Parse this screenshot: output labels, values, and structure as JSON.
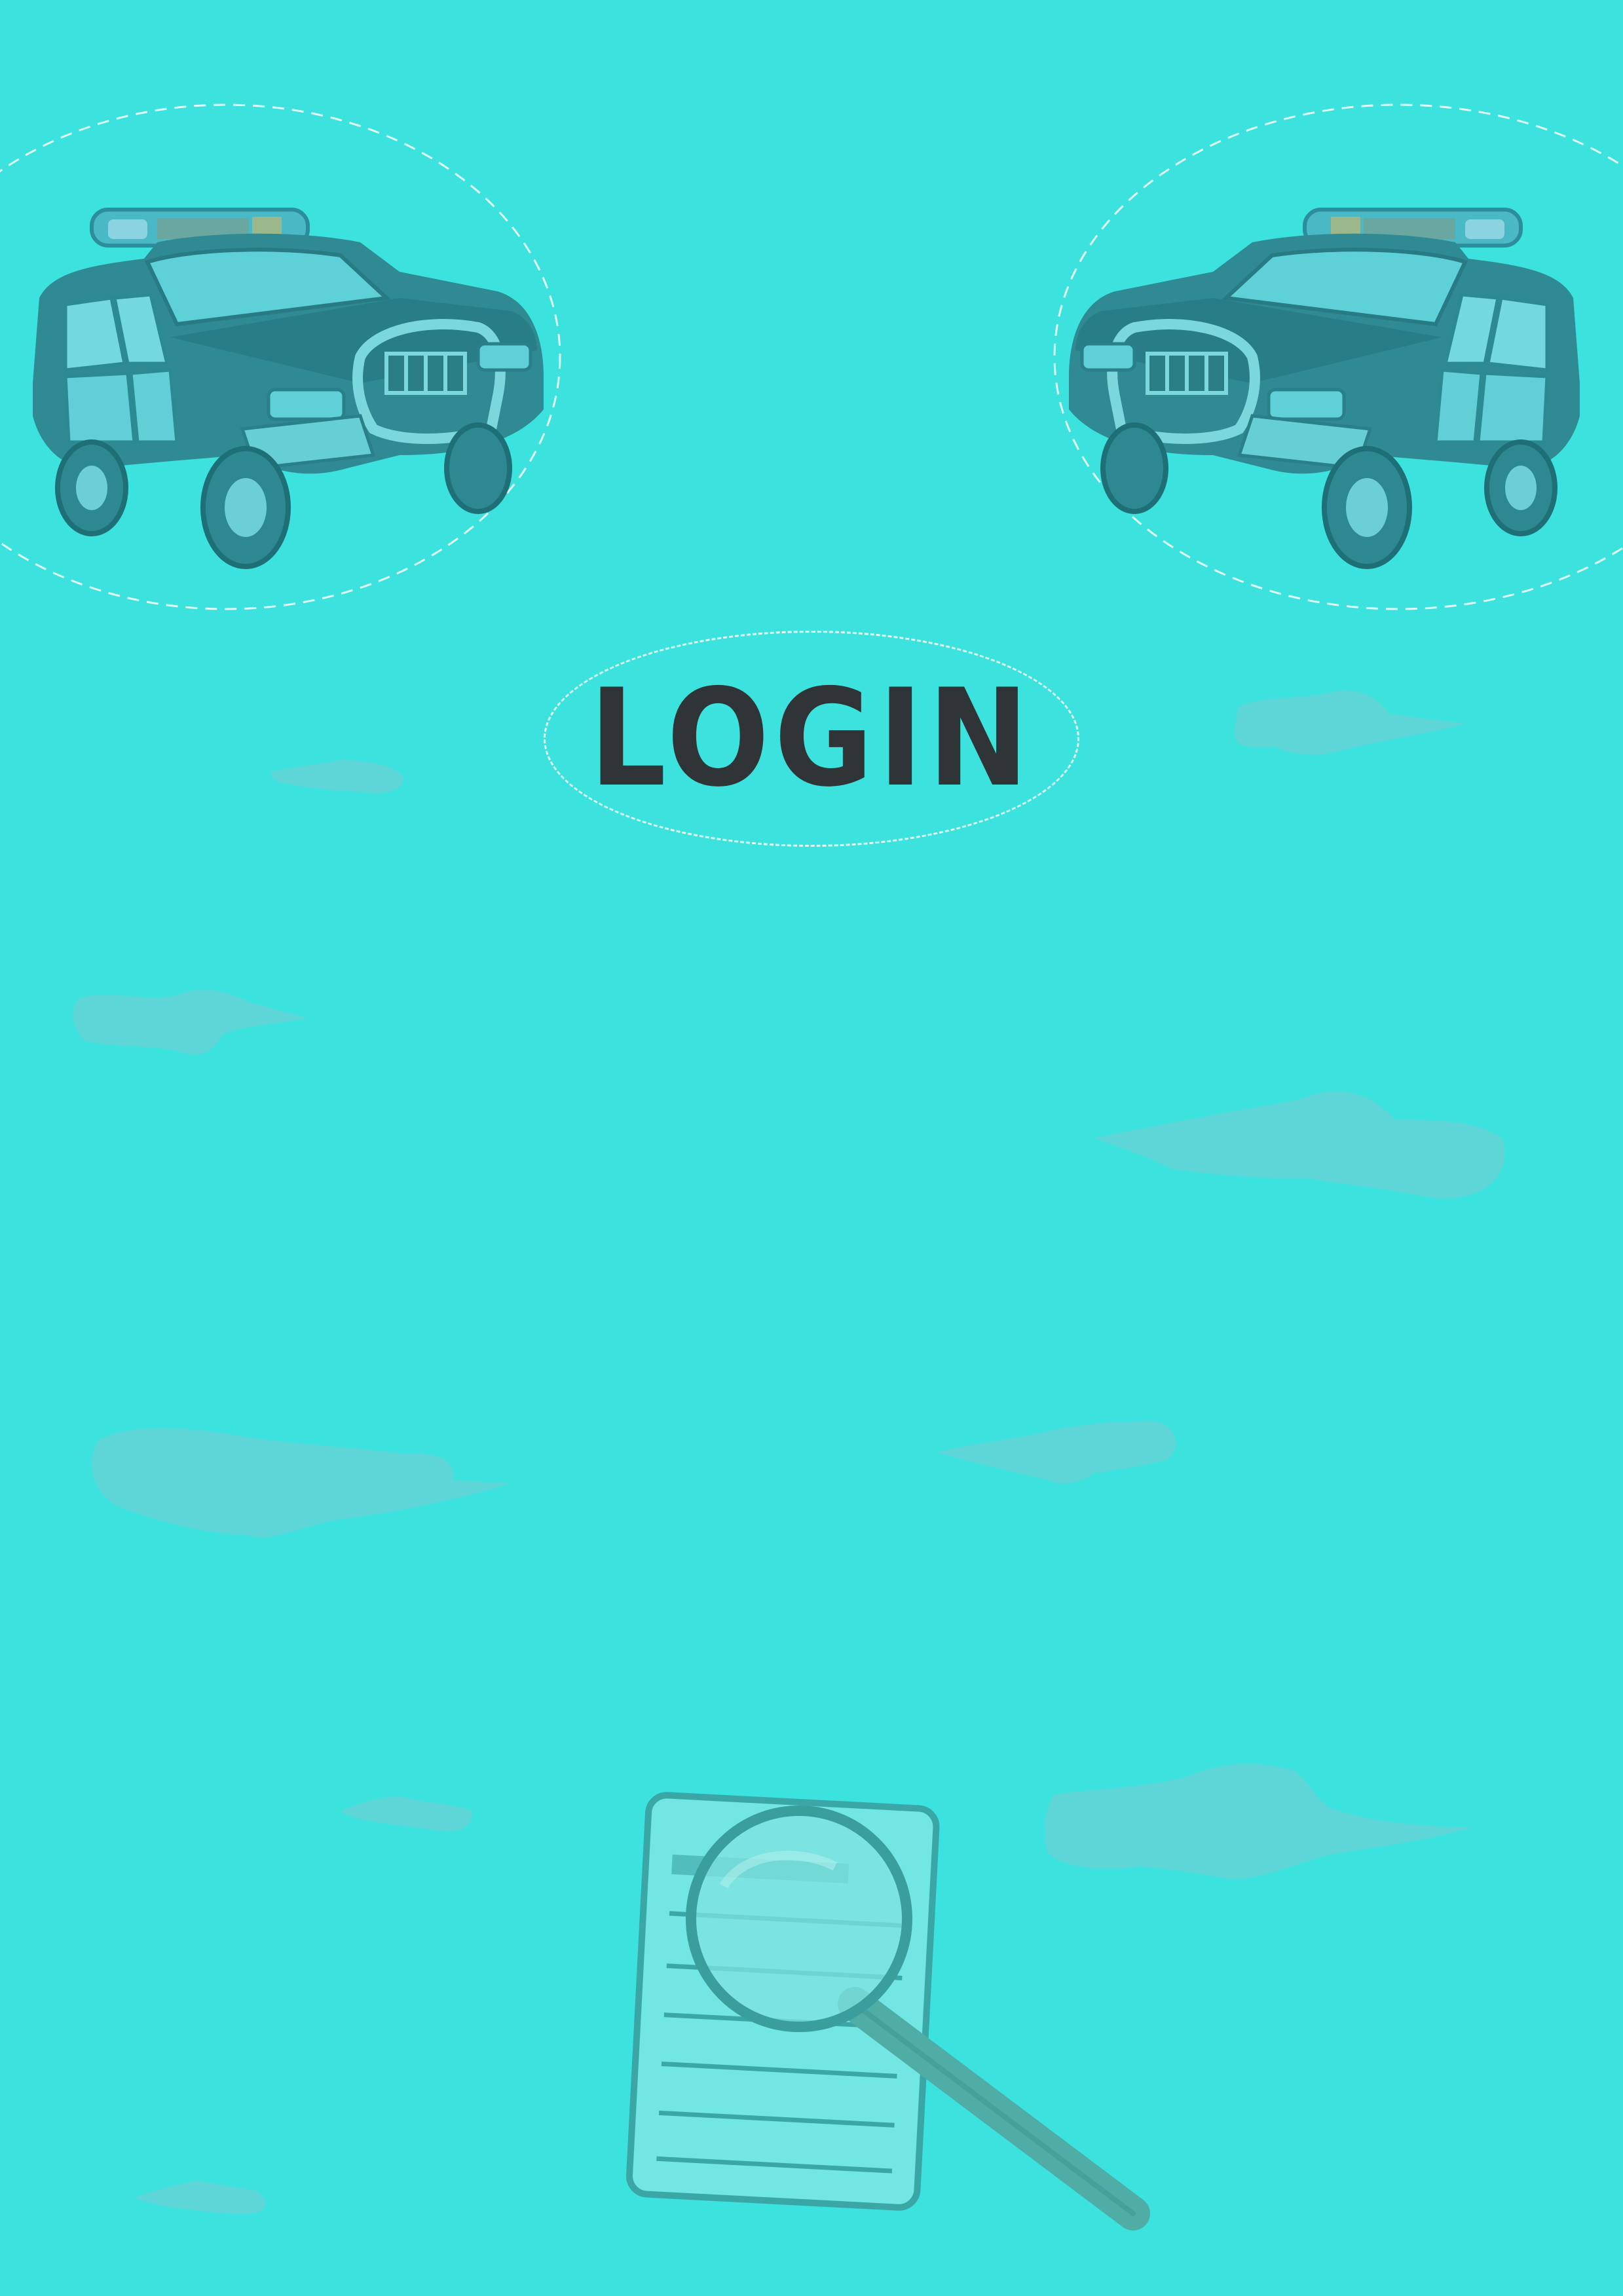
{
  "page": {
    "background_color": "#3be2de",
    "cloud_color": "#63d4d6"
  },
  "header": {
    "left_icon": "police-car-icon",
    "right_icon": "police-car-icon"
  },
  "login_button": {
    "label": "LOGIN",
    "text_color": "#2f3436"
  },
  "footer": {
    "icon": "document-magnifier-icon"
  }
}
